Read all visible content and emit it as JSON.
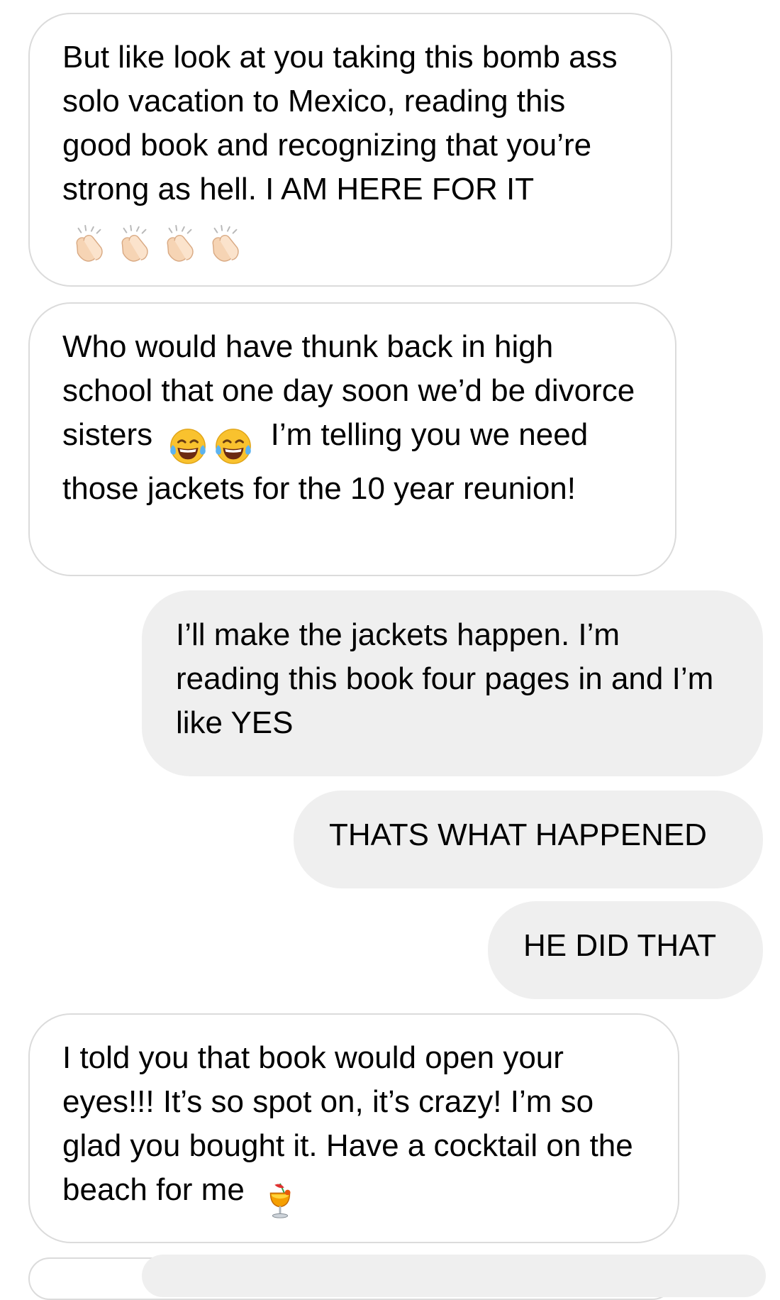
{
  "messages": [
    {
      "direction": "incoming",
      "text": "But like look at you taking this bomb ass solo vacation to Mexico, reading this good book and recognizing that you’re strong as hell. I AM HERE FOR IT",
      "emoji": [
        "clapping-hands",
        "clapping-hands",
        "clapping-hands",
        "clapping-hands"
      ]
    },
    {
      "direction": "incoming",
      "text_before_emoji": "Who would have thunk back in high school that one day soon we’d be divorce sisters",
      "emoji": [
        "tears-of-joy",
        "tears-of-joy"
      ],
      "text_after_emoji": "I’m telling you we need those jackets for the 10 year reunion!"
    },
    {
      "direction": "outgoing",
      "text": "I’ll make the jackets happen. I’m reading this book four pages in and I’m like YES"
    },
    {
      "direction": "outgoing",
      "text": "THATS WHAT HAPPENED"
    },
    {
      "direction": "outgoing",
      "text": "HE DID THAT"
    },
    {
      "direction": "incoming",
      "text": "I told you that book would open your eyes!!! It’s so spot on, it’s crazy! I’m so glad you bought it. Have a cocktail on the beach for me",
      "emoji": [
        "tropical-drink"
      ]
    }
  ],
  "colors": {
    "incoming_bg": "#ffffff",
    "incoming_border": "#dbdbdb",
    "outgoing_bg": "#efefef",
    "text": "#000000"
  }
}
